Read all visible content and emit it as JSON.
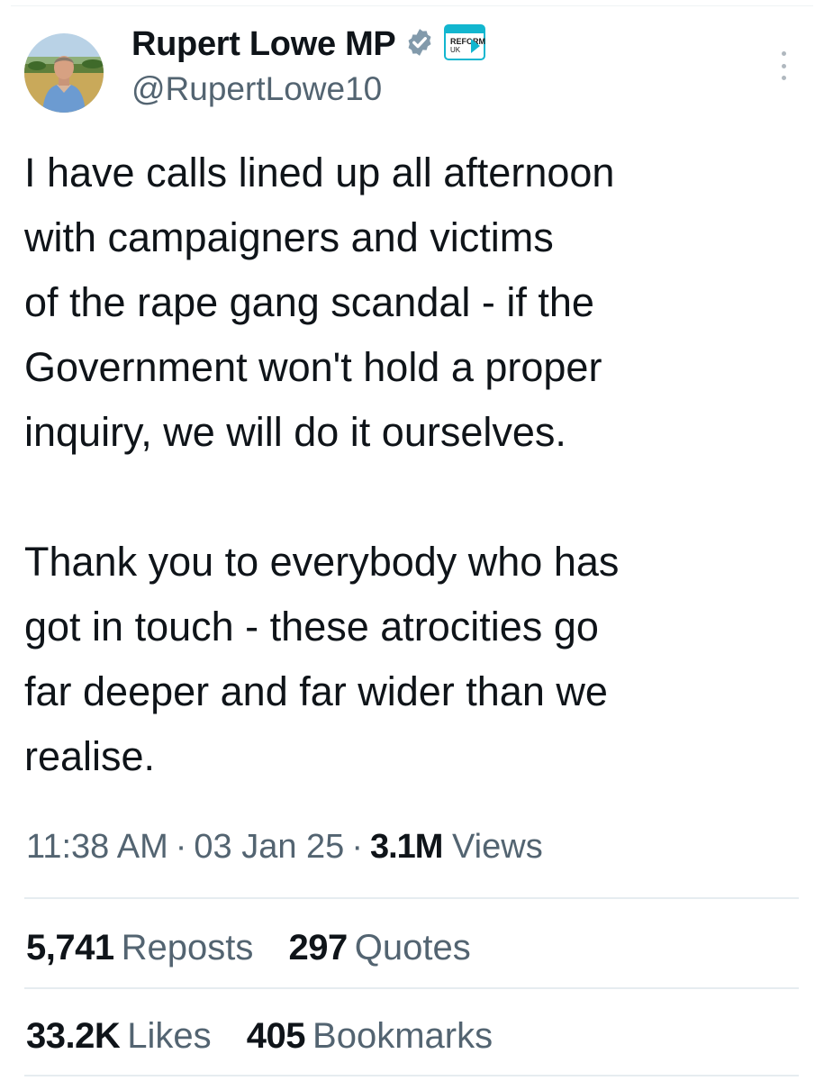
{
  "author": {
    "display_name": "Rupert Lowe MP",
    "handle": "@RupertLowe10",
    "verified_icon": "verified-badge-icon",
    "party_badge_text": [
      "REFORM",
      "UK"
    ],
    "party_badge_color": "#12b6cf",
    "verified_color": "#829aab"
  },
  "tweet": {
    "paragraphs": [
      [
        "I have calls lined up all afternoon",
        "with campaigners and victims",
        "of the rape gang scandal - if the",
        "Government won't hold a proper",
        "inquiry, we will do it ourselves."
      ],
      [
        "Thank you to everybody who has",
        "got in touch - these atrocities go",
        "far deeper and far wider than we",
        "realise."
      ]
    ]
  },
  "meta": {
    "time": "11:38 AM",
    "separator": "·",
    "date": "03 Jan 25",
    "views_count": "3.1M",
    "views_label": "Views"
  },
  "stats": {
    "row1": [
      {
        "count": "5,741",
        "label": "Reposts"
      },
      {
        "count": "297",
        "label": "Quotes"
      }
    ],
    "row2": [
      {
        "count": "33.2K",
        "label": "Likes"
      },
      {
        "count": "405",
        "label": "Bookmarks"
      }
    ]
  },
  "more_icon": "more-options-vertical-icon"
}
